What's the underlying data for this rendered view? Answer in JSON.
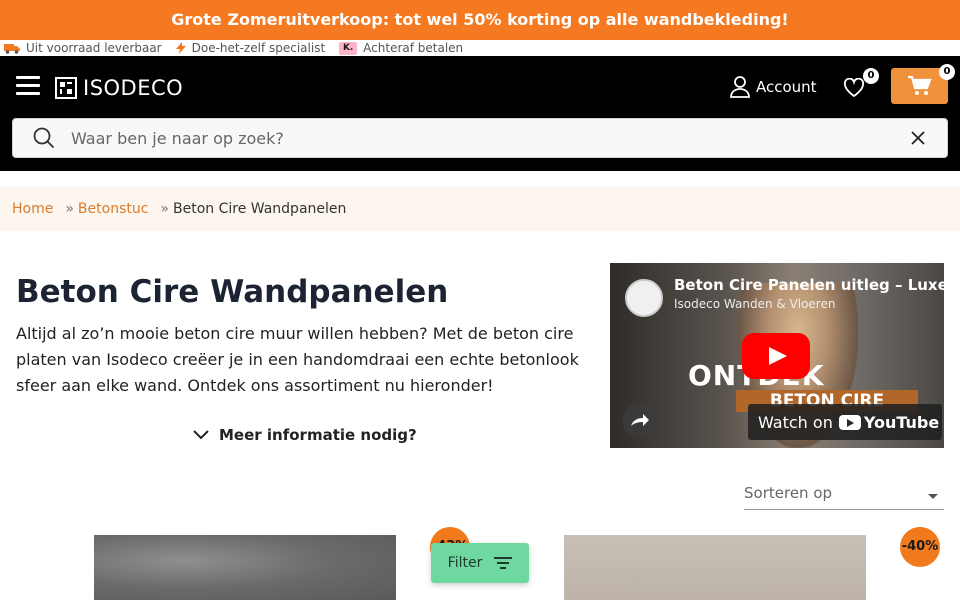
{
  "promo": {
    "text": "Grote Zomeruitverkoop: tot wel 50% korting op alle wandbekleding!"
  },
  "usp": [
    {
      "icon": "truck-icon",
      "label": "Uit voorraad leverbaar"
    },
    {
      "icon": "lightning-icon",
      "label": "Doe-het-zelf specialist"
    },
    {
      "icon": "klarna-icon",
      "label": "Achteraf betalen"
    }
  ],
  "header": {
    "logo": "ISODECO",
    "account_label": "Account",
    "wishlist_count": "0",
    "cart_count": "0"
  },
  "search": {
    "placeholder": "Waar ben je naar op zoek?"
  },
  "breadcrumb": {
    "home": "Home",
    "sep": "»",
    "parent": "Betonstuc",
    "current": "Beton Cire Wandpanelen"
  },
  "page": {
    "title": "Beton Cire Wandpanelen",
    "description": "Altijd al zo’n mooie beton cire muur willen hebben? Met de beton cire platen van Isodeco creëer je in een handomdraai een echte betonlook sfeer aan elke wand. Ontdek ons assortiment nu hieronder!",
    "more_info": "Meer informatie nodig?"
  },
  "video": {
    "title": "Beton Cire Panelen uitleg – Luxe",
    "channel": "Isodeco Wanden & Vloeren",
    "overlay_big": "ONTDEK",
    "overlay_sub": "BETON CIRE",
    "watch_on": "Watch on",
    "youtube": "YouTube"
  },
  "sort": {
    "label": "Sorteren op"
  },
  "products": [
    {
      "discount": "-43%"
    },
    {
      "discount": "-40%"
    }
  ],
  "filter": {
    "label": "Filter"
  },
  "colors": {
    "accent": "#f47921",
    "header_bg": "#000000",
    "link": "#d97c30",
    "filter_bg": "#6fd8a0"
  }
}
